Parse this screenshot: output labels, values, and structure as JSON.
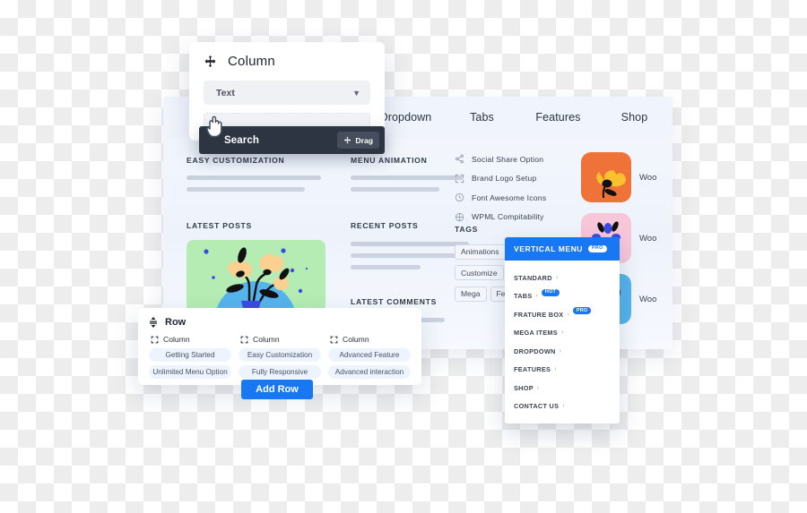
{
  "colors": {
    "accent_blue": "#1878f3",
    "dark_bar": "#2e3542",
    "panel_bg": "#ffffff",
    "preview_bg": "#f0f4fc"
  },
  "column_panel": {
    "title": "Column",
    "move_icon": "move-arrows-icon",
    "select_value": "Text",
    "chevron_icon": "chevron-down-icon"
  },
  "search_bar": {
    "label": "Search",
    "drag_label": "Drag",
    "drag_icon": "move-arrows-icon",
    "cursor_icon": "hand-cursor-icon"
  },
  "preview": {
    "nav_items": [
      "Dropdown",
      "Tabs",
      "Features",
      "Shop"
    ],
    "widgets": {
      "easy_customization": "EASY CUSTOMIZATION",
      "menu_animation": "MENU ANIMATION",
      "latest_posts": "LATEST POSTS",
      "recent_posts": "RECENT POSTS",
      "latest_comments": "LATEST COMMENTS",
      "tags": "TAGS"
    },
    "features": [
      {
        "label": "Social Share Option",
        "icon": "share-icon"
      },
      {
        "label": "Brand Logo Setup",
        "icon": "expand-icon"
      },
      {
        "label": "Font Awesome Icons",
        "icon": "clock-icon"
      },
      {
        "label": "WPML Compitability",
        "icon": "grid-plus-icon"
      }
    ],
    "tags": [
      "Animations",
      "Customize",
      "Mega",
      "Fe"
    ],
    "products": [
      {
        "name": "Woo",
        "thumb": "flower-orange-thumb"
      },
      {
        "name": "Woo",
        "thumb": "flower-pink-thumb"
      },
      {
        "name": "Woo",
        "thumb": "flower-blue-thumb"
      }
    ]
  },
  "row_panel": {
    "title": "Row",
    "move_icon": "move-vertical-icon",
    "column_label": "Column",
    "column_icon": "resize-icon",
    "columns": [
      {
        "label": "Column",
        "items": [
          "Getting Started",
          "Unlimited Menu Option"
        ]
      },
      {
        "label": "Column",
        "items": [
          "Easy Customization",
          "Fully Responsive"
        ]
      },
      {
        "label": "Column",
        "items": [
          "Advanced Feature",
          "Advanced interaction"
        ]
      }
    ],
    "add_row_label": "Add Row"
  },
  "vertical_menu": {
    "title": "VERTICAL MENU",
    "title_badge": "PRO",
    "arrow_icon": "chevron-right-icon",
    "items": [
      {
        "label": "STANDARD",
        "badge": null,
        "badge_type": null
      },
      {
        "label": "TABS",
        "badge": "HOT",
        "badge_type": "hot"
      },
      {
        "label": "FRATURE BOX",
        "badge": "PRO",
        "badge_type": "pro"
      },
      {
        "label": "MEGA ITEMS",
        "badge": null,
        "badge_type": null
      },
      {
        "label": "DROPDOWN",
        "badge": null,
        "badge_type": null
      },
      {
        "label": "FEATURES",
        "badge": null,
        "badge_type": null
      },
      {
        "label": "SHOP",
        "badge": null,
        "badge_type": null
      },
      {
        "label": "CONTACT US",
        "badge": null,
        "badge_type": null
      }
    ]
  }
}
